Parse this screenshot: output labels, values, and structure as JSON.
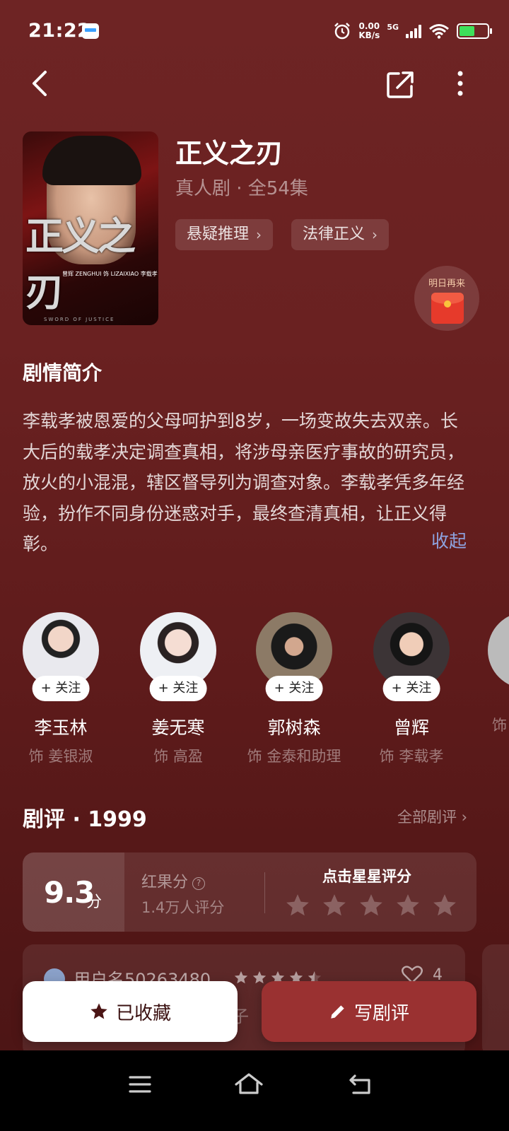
{
  "status_bar": {
    "time": "21:22",
    "net_speed_value": "0.00",
    "net_speed_unit": "KB/s",
    "network": "5G",
    "battery_level": 0.55,
    "icons": [
      "app-notification-icon",
      "alarm-icon",
      "signal-icon",
      "wifi-icon",
      "battery-icon"
    ]
  },
  "nav": {
    "icons": [
      "back-icon",
      "share-icon",
      "more-icon"
    ]
  },
  "show": {
    "title": "正义之刃",
    "meta": "真人剧 · 全54集",
    "tags": [
      {
        "label": "悬疑推理"
      },
      {
        "label": "法律正义"
      }
    ],
    "poster": {
      "credit": "曾辉 ZENGHUI 饰 LIZAIXIAO 李载孝",
      "title_art": "正义之刃",
      "subtitle_art": "SWORD OF JUSTICE"
    }
  },
  "reward": {
    "label": "明日再来"
  },
  "synopsis": {
    "title": "剧情简介",
    "text": "李载孝被恩爱的父母呵护到8岁，一场变故失去双亲。长大后的载孝决定调查真相，将涉母亲医疗事故的研究员，放火的小混混，辖区督导列为调查对象。李载孝凭多年经验，扮作不同身份迷惑对手，最终查清真相，让正义得彰。",
    "collapse_label": "收起"
  },
  "cast": [
    {
      "name": "李玉林",
      "role": "饰 姜银淑",
      "follow": "+ 关注"
    },
    {
      "name": "姜无寒",
      "role": "饰 高盈",
      "follow": "+ 关注"
    },
    {
      "name": "郭树森",
      "role": "饰 金泰和助理",
      "follow": "+ 关注"
    },
    {
      "name": "曾辉",
      "role": "饰 李载孝",
      "follow": "+ 关注"
    },
    {
      "name": "",
      "role": "饰",
      "follow": ""
    }
  ],
  "reviews": {
    "title": "剧评 · 1999",
    "all_label": "全部剧评 ›",
    "score": "9.3",
    "score_unit": "分",
    "hongguo_label": "红果分",
    "help": "?",
    "rater_count": "1.4万人评分",
    "tap_prompt": "点击星星评分",
    "first_review": {
      "user": "用户名50263480",
      "stars": 4.5,
      "likes": "4",
      "peek": "子"
    }
  },
  "actions": {
    "favorite_label": "已收藏",
    "write_label": "写剧评"
  },
  "colors": {
    "background": "#6a2121",
    "accent_button": "#9a3131",
    "link": "#8ea3e0",
    "battery": "#3ee05a"
  }
}
